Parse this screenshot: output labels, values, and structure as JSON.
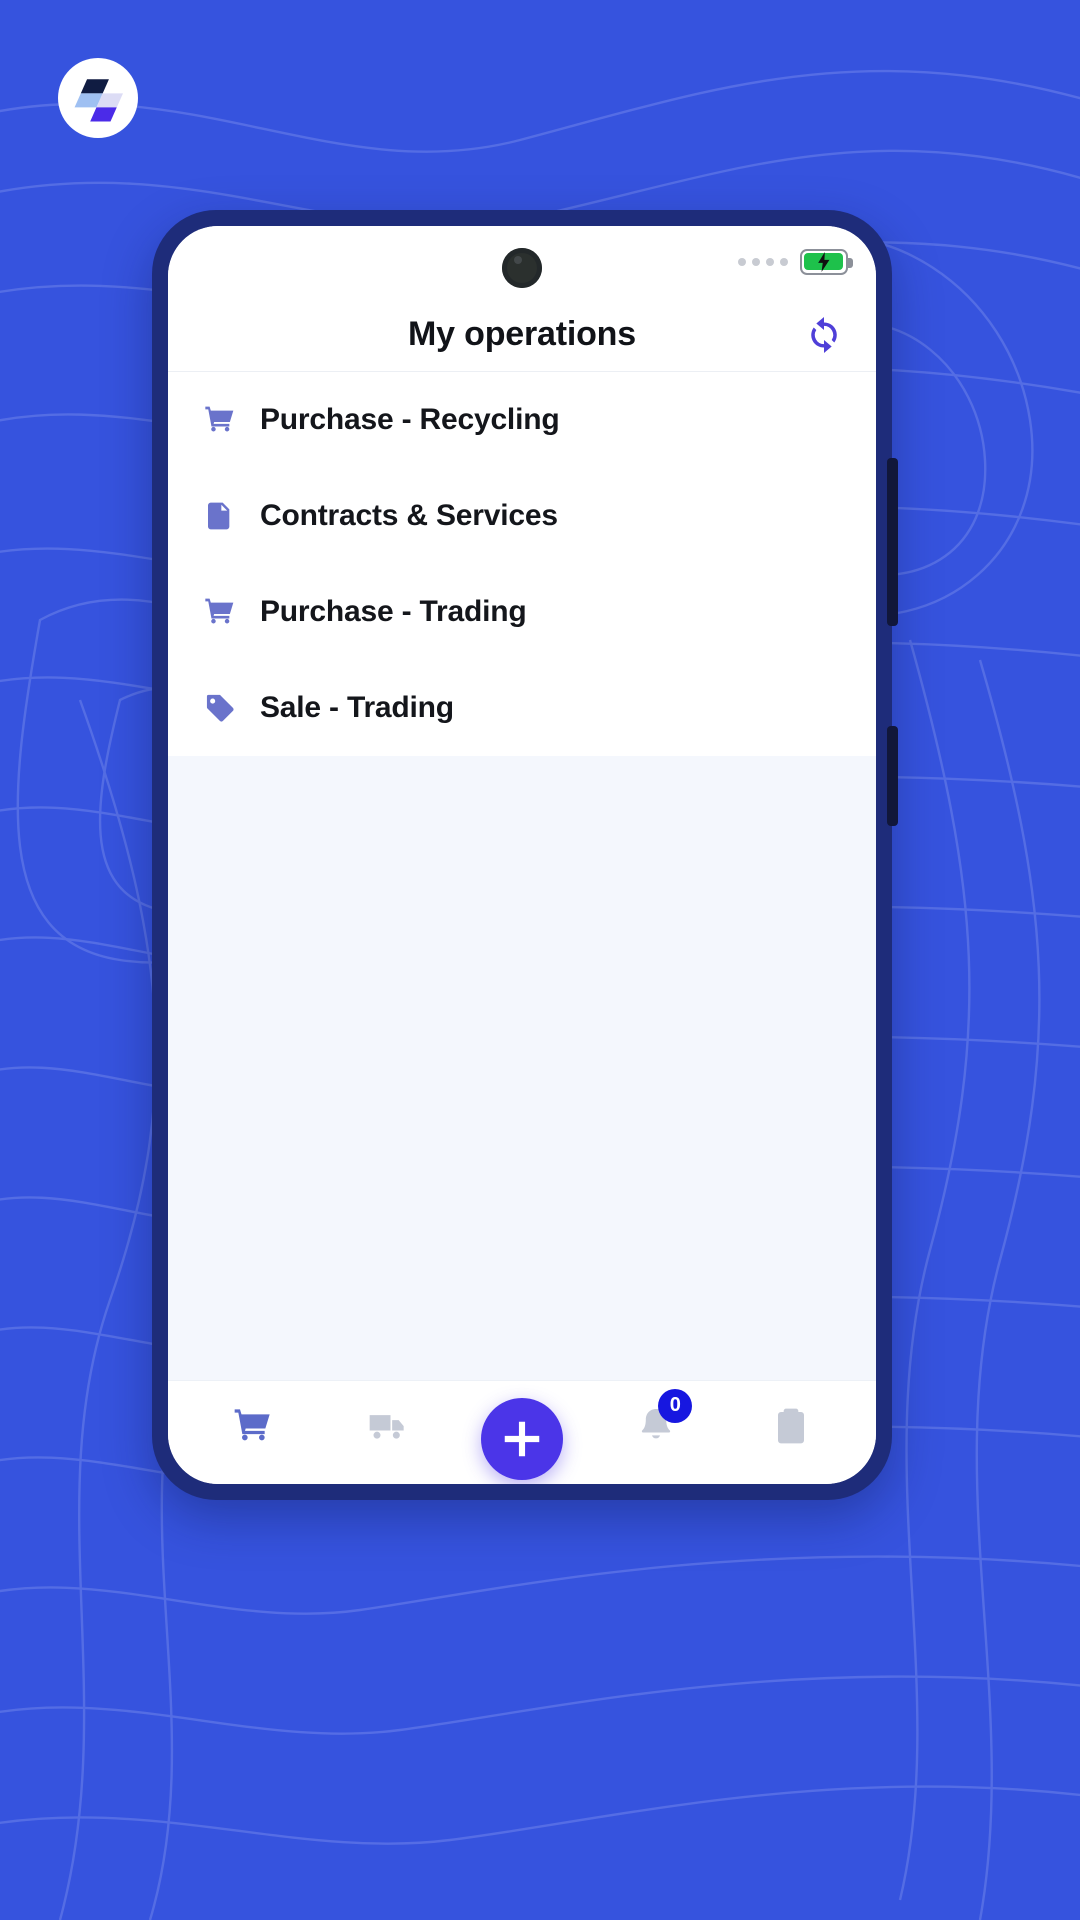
{
  "brand": {
    "logo_icon": "cube-logo-icon",
    "colors": {
      "background": "#3653DE",
      "device_frame": "#1E2C7A",
      "accent_purple": "#4B35E8",
      "icon_purple": "#6A73CB",
      "badge_blue": "#1717E0",
      "body_bg": "#F4F7FD"
    }
  },
  "statusbar": {
    "signal_icon": "signal-dots-icon",
    "battery_icon": "battery-charging-icon",
    "battery_charging": true
  },
  "header": {
    "title": "My operations",
    "sync_icon": "sync-refresh-icon"
  },
  "operations": [
    {
      "label": "Purchase - Recycling",
      "icon": "shopping-cart-icon"
    },
    {
      "label": "Contracts & Services",
      "icon": "document-icon"
    },
    {
      "label": "Purchase - Trading",
      "icon": "shopping-cart-icon"
    },
    {
      "label": "Sale - Trading",
      "icon": "price-tag-icon"
    }
  ],
  "bottom_nav": {
    "items": [
      {
        "name": "cart",
        "icon": "shopping-cart-icon",
        "active": true
      },
      {
        "name": "deliveries",
        "icon": "truck-icon",
        "active": false
      },
      {
        "name": "notifications",
        "icon": "bell-icon",
        "active": false,
        "badge": "0"
      },
      {
        "name": "tasks",
        "icon": "clipboard-icon",
        "active": false
      }
    ],
    "fab": {
      "label": "+",
      "icon": "plus-icon"
    }
  }
}
